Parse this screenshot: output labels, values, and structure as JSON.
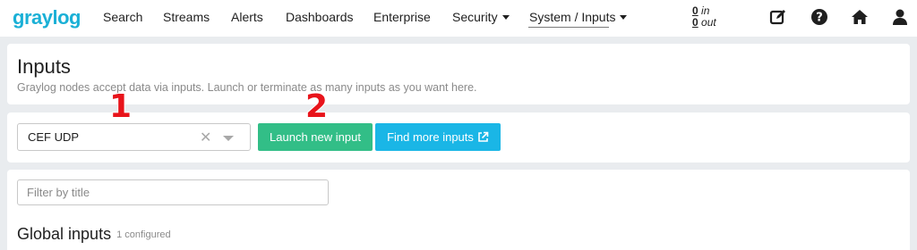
{
  "navbar": {
    "logo": "graylog",
    "items": [
      {
        "label": "Search"
      },
      {
        "label": "Streams"
      },
      {
        "label": "Alerts"
      },
      {
        "label": "Dashboards"
      },
      {
        "label": "Enterprise"
      },
      {
        "label": "Security"
      },
      {
        "label": "System / Inputs"
      }
    ],
    "throughput": {
      "in_value": "0",
      "in_label": "in",
      "out_value": "0",
      "out_label": "out"
    },
    "icons": [
      "edit-icon",
      "help-icon",
      "home-icon",
      "user-icon"
    ]
  },
  "header": {
    "title": "Inputs",
    "description": "Graylog nodes accept data via inputs. Launch or terminate as many inputs as you want here."
  },
  "launch": {
    "selected_input": "CEF UDP",
    "launch_button": "Launch new input",
    "find_button": "Find more inputs"
  },
  "list": {
    "filter_placeholder": "Filter by title",
    "section_title": "Global inputs",
    "section_count": "1 configured"
  },
  "markers": [
    "1",
    "2"
  ],
  "colors": {
    "brand": "#1ab0d6",
    "launch": "#32be87",
    "find": "#1ab6e6",
    "marker": "#e8141b"
  }
}
